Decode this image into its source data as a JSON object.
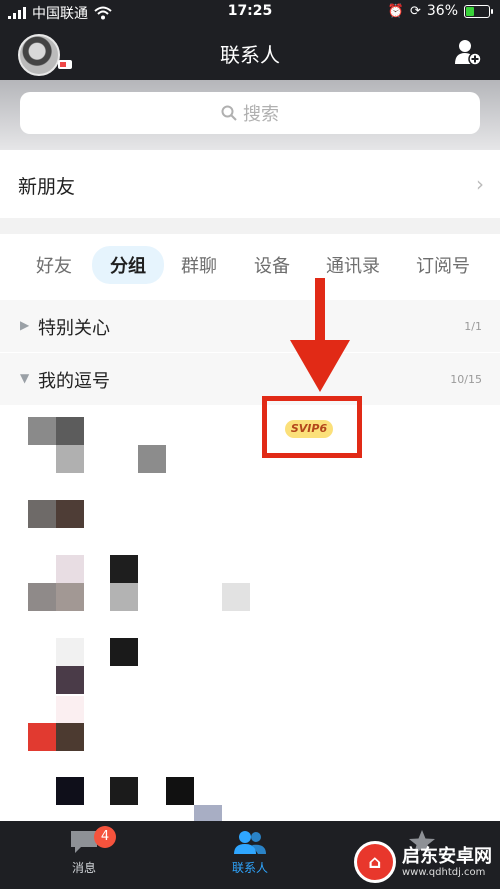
{
  "status_bar": {
    "carrier": "中国联通",
    "time": "17:25",
    "battery": "36%"
  },
  "header": {
    "title": "联系人"
  },
  "search": {
    "placeholder": "搜索"
  },
  "new_friends": {
    "label": "新朋友"
  },
  "tabs": [
    {
      "label": "好友"
    },
    {
      "label": "分组",
      "active": true
    },
    {
      "label": "群聊"
    },
    {
      "label": "设备"
    },
    {
      "label": "通讯录"
    },
    {
      "label": "订阅号"
    }
  ],
  "groups": [
    {
      "name": "特别关心",
      "count": "1/1"
    },
    {
      "name": "我的逗号",
      "count": "10/15"
    }
  ],
  "badge": {
    "label": "SVIP6"
  },
  "bottom_tabs": [
    {
      "label": "消息",
      "badge": "4"
    },
    {
      "label": "联系人",
      "active": true
    },
    {
      "label": "动态"
    }
  ],
  "watermark": {
    "title": "启东安卓网",
    "url": "www.qdhtdj.com"
  },
  "colors": {
    "nav_bg": "#1e1f23",
    "accent": "#2fa6ff",
    "annotation_red": "#e12a16"
  }
}
